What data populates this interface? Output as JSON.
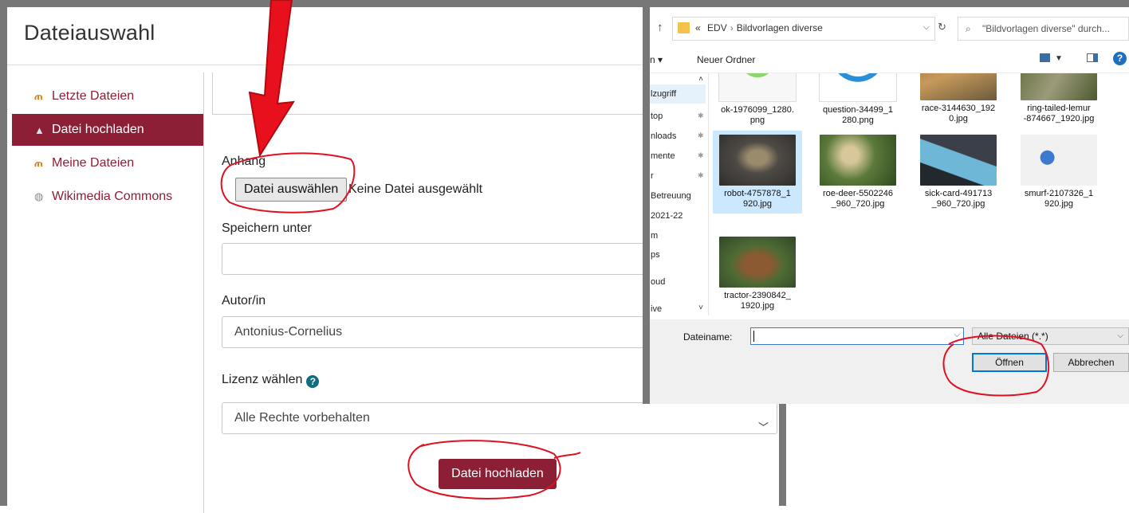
{
  "moodle": {
    "title": "Dateiauswahl",
    "sidebar": [
      {
        "label": "Letzte Dateien",
        "icon": "moodle-icon"
      },
      {
        "label": "Datei hochladen",
        "icon": "upload-icon"
      },
      {
        "label": "Meine Dateien",
        "icon": "moodle-icon"
      },
      {
        "label": "Wikimedia Commons",
        "icon": "wikimedia-icon"
      }
    ],
    "attachment_label": "Anhang",
    "choose_button": "Datei auswählen",
    "no_file": "Keine Datei ausgewählt",
    "save_as_label": "Speichern unter",
    "save_as_value": "",
    "author_label": "Autor/in",
    "author_value": "Antonius-Cornelius",
    "license_label": "Lizenz wählen",
    "license_value": "Alle Rechte vorbehalten",
    "upload_button": "Datei hochladen"
  },
  "dialog": {
    "path": [
      "EDV",
      "Bildvorlagen diverse"
    ],
    "path_prefix": "«",
    "search_placeholder": "\"Bildvorlagen diverse\" durch...",
    "organize": "n ▾",
    "new_folder": "Neuer Ordner",
    "nav": [
      {
        "label": "lzugriff"
      },
      {
        "label": "top"
      },
      {
        "label": "nloads"
      },
      {
        "label": "mente"
      },
      {
        "label": "r"
      },
      {
        "label": "Betreuung"
      },
      {
        "label": "2021-22"
      },
      {
        "label": "m"
      },
      {
        "label": "ps"
      },
      {
        "label": "oud"
      },
      {
        "label": "ive"
      }
    ],
    "files": [
      {
        "name": "ok-1976099_1280.\npng"
      },
      {
        "name": "question-34499_1\n280.png"
      },
      {
        "name": "race-3144630_192\n0.jpg"
      },
      {
        "name": "ring-tailed-lemur\n-874667_1920.jpg"
      },
      {
        "name": "robot-4757878_1\n920.jpg"
      },
      {
        "name": "roe-deer-5502246\n_960_720.jpg"
      },
      {
        "name": "sick-card-491713\n_960_720.jpg"
      },
      {
        "name": "smurf-2107326_1\n920.jpg"
      },
      {
        "name": "tractor-2390842_\n1920.jpg"
      }
    ],
    "filename_label": "Dateiname:",
    "filename_value": "",
    "filetype": "Alle Dateien (*.*)",
    "open_button": "Öffnen",
    "cancel_button": "Abbrechen"
  },
  "colors": {
    "moodle_primary": "#8c1f35",
    "annotation_red": "#e8101c",
    "selection_blue": "#cce8ff"
  }
}
